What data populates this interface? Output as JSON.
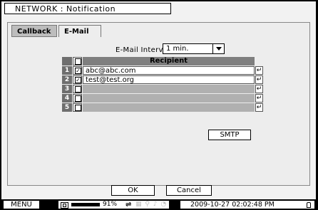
{
  "window": {
    "title": "NETWORK : Notification"
  },
  "tabs": [
    {
      "label": "Callback",
      "active": false
    },
    {
      "label": "E-Mail",
      "active": true
    }
  ],
  "email_interval": {
    "label": "E-Mail Interval :",
    "value": "1 min."
  },
  "table": {
    "header": {
      "recipient": "Recipient"
    },
    "rows": [
      {
        "num": "1",
        "checked": true,
        "recipient": "abc@abc.com",
        "enter": "↵"
      },
      {
        "num": "2",
        "checked": true,
        "recipient": "test@test.org",
        "enter": "↵"
      },
      {
        "num": "3",
        "checked": false,
        "recipient": "",
        "enter": "↵"
      },
      {
        "num": "4",
        "checked": false,
        "recipient": "",
        "enter": "↵"
      },
      {
        "num": "5",
        "checked": false,
        "recipient": "",
        "enter": "↵"
      }
    ]
  },
  "buttons": {
    "smtp": "SMTP",
    "ok": "OK",
    "cancel": "Cancel"
  },
  "status": {
    "menu": "MENU",
    "disk_percent": "91%",
    "datetime": "2009-10-27 02:02:48 PM",
    "icons": [
      "disk-icon",
      "network-icon",
      "lock-icon"
    ]
  }
}
